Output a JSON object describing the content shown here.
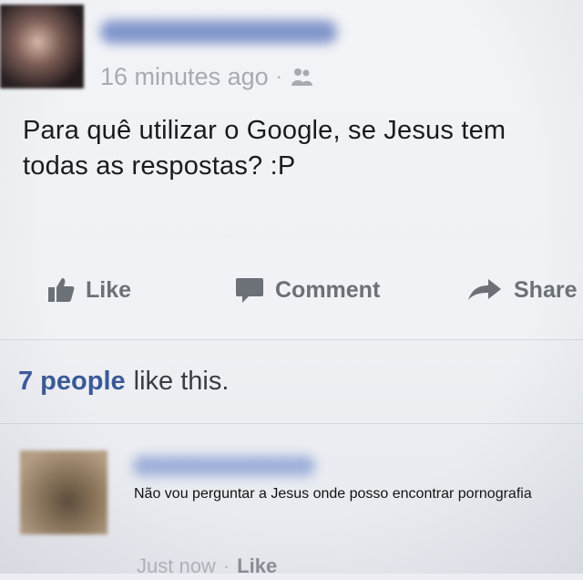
{
  "post": {
    "timestamp": "16 minutes ago",
    "separator": "·",
    "audience_icon": "friends-icon",
    "text": "Para quê utilizar o Google, se Jesus tem todas as respostas? :P"
  },
  "actions": {
    "like_label": "Like",
    "like_icon": "thumbs-up-icon",
    "comment_label": "Comment",
    "comment_icon": "speech-bubble-icon",
    "share_label": "Share",
    "share_icon": "share-arrow-icon"
  },
  "likes": {
    "count_text": "7 people",
    "suffix": "like this."
  },
  "comment": {
    "text": "Não vou perguntar a Jesus onde posso encontrar pornografia",
    "timestamp": "Just now",
    "separator": "·",
    "like_label": "Like"
  },
  "colors": {
    "link_blue": "#3b5998",
    "action_gray": "#6c7077",
    "background": "#eef0f4"
  }
}
